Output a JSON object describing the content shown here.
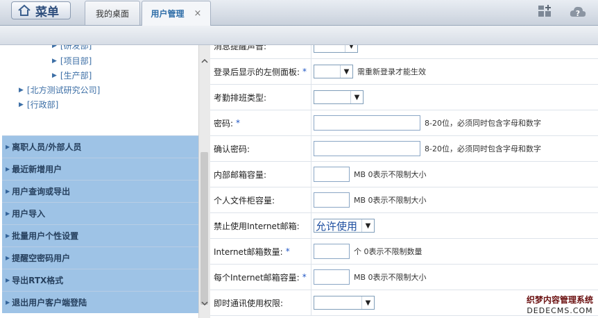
{
  "topbar": {
    "menu_label": "菜单",
    "tabs": [
      {
        "label": "我的桌面"
      },
      {
        "label": "用户管理",
        "close": "×"
      }
    ]
  },
  "tree": [
    {
      "label": "[研发部]"
    },
    {
      "label": "[项目部]"
    },
    {
      "label": "[生产部]"
    },
    {
      "label": "[北方测试研究公司]"
    },
    {
      "label": "[行政部]"
    }
  ],
  "groups": [
    {
      "label": "离职人员/外部人员"
    },
    {
      "label": "最近新增用户"
    },
    {
      "label": "用户查询或导出"
    },
    {
      "label": "用户导入"
    },
    {
      "label": "批量用户个性设置"
    },
    {
      "label": "提醒空密码用户"
    },
    {
      "label": "导出RTX格式"
    },
    {
      "label": "退出用户客户端登陆"
    }
  ],
  "form": {
    "sound_label": "消息提醒声音:",
    "left_panel_label": "登录后显示的左侧面板:",
    "left_panel_hint": "需重新登录才能生效",
    "attendance_label": "考勤排班类型:",
    "password_label": "密码:",
    "password_hint": "8-20位，必须同时包含字母和数字",
    "confirm_label": "确认密码:",
    "confirm_hint": "8-20位，必须同时包含字母和数字",
    "mailbox_label": "内部邮箱容量:",
    "mailbox_hint": "MB 0表示不限制大小",
    "cabinet_label": "个人文件柜容量:",
    "cabinet_hint": "MB 0表示不限制大小",
    "internet_mail_label": "禁止使用Internet邮箱:",
    "internet_mail_value": "允许使用",
    "internet_count_label": "Internet邮箱数量:",
    "internet_count_hint": "个 0表示不限制数量",
    "internet_size_label": "每个Internet邮箱容量:",
    "internet_size_hint": "MB 0表示不限制大小",
    "im_label": "即时通讯使用权限:",
    "required_mark": "*"
  },
  "watermark": {
    "line1": "织梦内容管理系统",
    "line2": "DEDECMS.COM"
  },
  "colors": {
    "accent": "#2f6ea8",
    "group_bg": "#9ec3e6",
    "required": "#1f55c4"
  }
}
